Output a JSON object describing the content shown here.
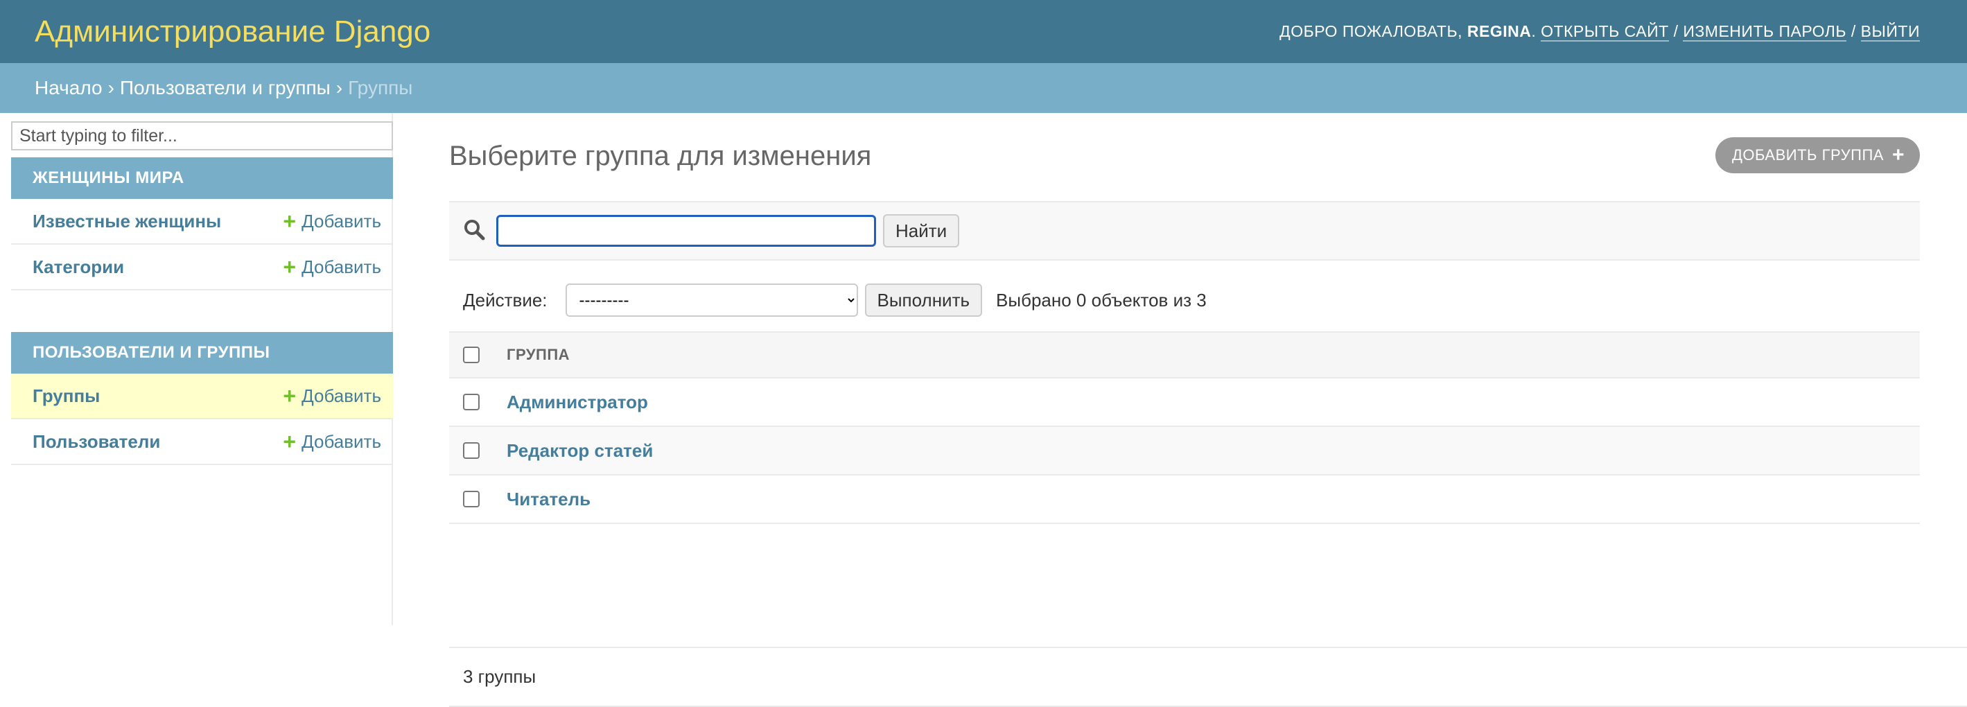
{
  "header": {
    "brand": "Администрирование Django",
    "welcome": "Добро пожаловать,",
    "username": "REGINA",
    "open_site": "Открыть сайт",
    "change_password": "Изменить пароль",
    "logout": "Выйти"
  },
  "breadcrumbs": {
    "home": "Начало",
    "app": "Пользователи и группы",
    "current": "Группы"
  },
  "sidebar": {
    "filter_placeholder": "Start typing to filter...",
    "modules": [
      {
        "caption": "Женщины мира",
        "models": [
          {
            "label": "Известные женщины",
            "add": "Добавить"
          },
          {
            "label": "Категории",
            "add": "Добавить"
          }
        ]
      },
      {
        "caption": "Пользователи и группы",
        "models": [
          {
            "label": "Группы",
            "add": "Добавить"
          },
          {
            "label": "Пользователи",
            "add": "Добавить"
          }
        ]
      }
    ]
  },
  "content": {
    "title": "Выберите группа для изменения",
    "add_button": "Добавить группа",
    "search_value": "",
    "search_button": "Найти",
    "action_label": "Действие:",
    "action_selected": "---------",
    "run_button": "Выполнить",
    "counter": "Выбрано 0 объектов из 3",
    "column_header": "Группа",
    "rows": [
      "Администратор",
      "Редактор статей",
      "Читатель"
    ],
    "paginator": "3 группы"
  },
  "colors": {
    "header_bg": "#417690",
    "brand": "#f5dd5d",
    "breadcrumbs_bg": "#79aec8",
    "link": "#447e9b",
    "add_green": "#70bf2b",
    "current_row": "#ffffcc"
  },
  "icons": {
    "search": "search-icon",
    "add": "plus-icon"
  }
}
